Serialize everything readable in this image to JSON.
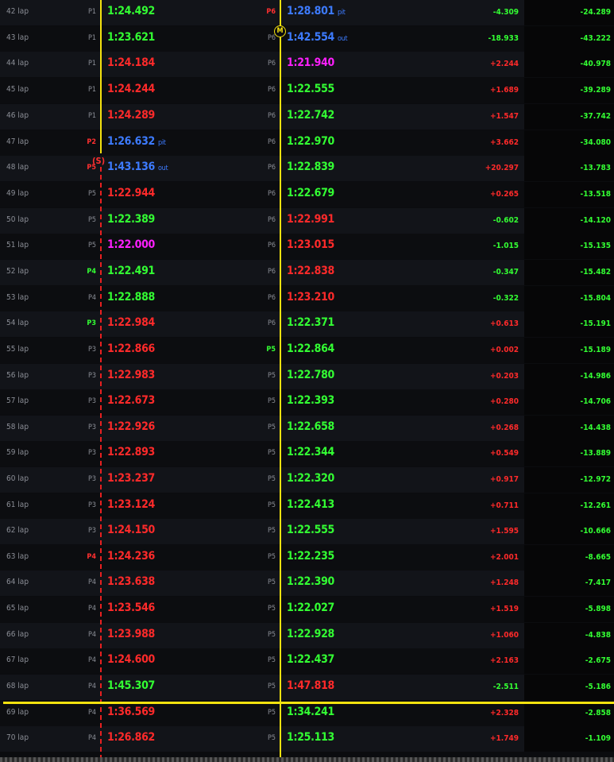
{
  "markers": {
    "driver_b_marker": "M",
    "driver_a_marker": "(S)"
  },
  "rows": [
    {
      "lap": "42 lap",
      "posA": "P1",
      "posAc": "",
      "timeA": "1:24.492",
      "colA": "green",
      "tagA": "",
      "posB": "P6",
      "posBc": "red",
      "timeB": "1:28.801",
      "colB": "blue",
      "tagB": "pit",
      "delta": "-4.309",
      "dcol": "green",
      "gap": "-24.289",
      "gcol": "green"
    },
    {
      "lap": "43 lap",
      "posA": "P1",
      "posAc": "",
      "timeA": "1:23.621",
      "colA": "green",
      "tagA": "",
      "posB": "P6",
      "posBc": "",
      "timeB": "1:42.554",
      "colB": "blue",
      "tagB": "out",
      "delta": "-18.933",
      "dcol": "green",
      "gap": "-43.222",
      "gcol": "green"
    },
    {
      "lap": "44 lap",
      "posA": "P1",
      "posAc": "",
      "timeA": "1:24.184",
      "colA": "red",
      "tagA": "",
      "posB": "P6",
      "posBc": "",
      "timeB": "1:21.940",
      "colB": "purple",
      "tagB": "",
      "delta": "+2.244",
      "dcol": "red",
      "gap": "-40.978",
      "gcol": "green"
    },
    {
      "lap": "45 lap",
      "posA": "P1",
      "posAc": "",
      "timeA": "1:24.244",
      "colA": "red",
      "tagA": "",
      "posB": "P6",
      "posBc": "",
      "timeB": "1:22.555",
      "colB": "green",
      "tagB": "",
      "delta": "+1.689",
      "dcol": "red",
      "gap": "-39.289",
      "gcol": "green"
    },
    {
      "lap": "46 lap",
      "posA": "P1",
      "posAc": "",
      "timeA": "1:24.289",
      "colA": "red",
      "tagA": "",
      "posB": "P6",
      "posBc": "",
      "timeB": "1:22.742",
      "colB": "green",
      "tagB": "",
      "delta": "+1.547",
      "dcol": "red",
      "gap": "-37.742",
      "gcol": "green"
    },
    {
      "lap": "47 lap",
      "posA": "P2",
      "posAc": "red",
      "timeA": "1:26.632",
      "colA": "blue",
      "tagA": "pit",
      "posB": "P6",
      "posBc": "",
      "timeB": "1:22.970",
      "colB": "green",
      "tagB": "",
      "delta": "+3.662",
      "dcol": "red",
      "gap": "-34.080",
      "gcol": "green"
    },
    {
      "lap": "48 lap",
      "posA": "P5",
      "posAc": "red",
      "timeA": "1:43.136",
      "colA": "blue",
      "tagA": "out",
      "posB": "P6",
      "posBc": "",
      "timeB": "1:22.839",
      "colB": "green",
      "tagB": "",
      "delta": "+20.297",
      "dcol": "red",
      "gap": "-13.783",
      "gcol": "green"
    },
    {
      "lap": "49 lap",
      "posA": "P5",
      "posAc": "",
      "timeA": "1:22.944",
      "colA": "red",
      "tagA": "",
      "posB": "P6",
      "posBc": "",
      "timeB": "1:22.679",
      "colB": "green",
      "tagB": "",
      "delta": "+0.265",
      "dcol": "red",
      "gap": "-13.518",
      "gcol": "green"
    },
    {
      "lap": "50 lap",
      "posA": "P5",
      "posAc": "",
      "timeA": "1:22.389",
      "colA": "green",
      "tagA": "",
      "posB": "P6",
      "posBc": "",
      "timeB": "1:22.991",
      "colB": "red",
      "tagB": "",
      "delta": "-0.602",
      "dcol": "green",
      "gap": "-14.120",
      "gcol": "green"
    },
    {
      "lap": "51 lap",
      "posA": "P5",
      "posAc": "",
      "timeA": "1:22.000",
      "colA": "purple",
      "tagA": "",
      "posB": "P6",
      "posBc": "",
      "timeB": "1:23.015",
      "colB": "red",
      "tagB": "",
      "delta": "-1.015",
      "dcol": "green",
      "gap": "-15.135",
      "gcol": "green"
    },
    {
      "lap": "52 lap",
      "posA": "P4",
      "posAc": "green",
      "timeA": "1:22.491",
      "colA": "green",
      "tagA": "",
      "posB": "P6",
      "posBc": "",
      "timeB": "1:22.838",
      "colB": "red",
      "tagB": "",
      "delta": "-0.347",
      "dcol": "green",
      "gap": "-15.482",
      "gcol": "green"
    },
    {
      "lap": "53 lap",
      "posA": "P4",
      "posAc": "",
      "timeA": "1:22.888",
      "colA": "green",
      "tagA": "",
      "posB": "P6",
      "posBc": "",
      "timeB": "1:23.210",
      "colB": "red",
      "tagB": "",
      "delta": "-0.322",
      "dcol": "green",
      "gap": "-15.804",
      "gcol": "green"
    },
    {
      "lap": "54 lap",
      "posA": "P3",
      "posAc": "green",
      "timeA": "1:22.984",
      "colA": "red",
      "tagA": "",
      "posB": "P6",
      "posBc": "",
      "timeB": "1:22.371",
      "colB": "green",
      "tagB": "",
      "delta": "+0.613",
      "dcol": "red",
      "gap": "-15.191",
      "gcol": "green"
    },
    {
      "lap": "55 lap",
      "posA": "P3",
      "posAc": "",
      "timeA": "1:22.866",
      "colA": "red",
      "tagA": "",
      "posB": "P5",
      "posBc": "green",
      "timeB": "1:22.864",
      "colB": "green",
      "tagB": "",
      "delta": "+0.002",
      "dcol": "red",
      "gap": "-15.189",
      "gcol": "green"
    },
    {
      "lap": "56 lap",
      "posA": "P3",
      "posAc": "",
      "timeA": "1:22.983",
      "colA": "red",
      "tagA": "",
      "posB": "P5",
      "posBc": "",
      "timeB": "1:22.780",
      "colB": "green",
      "tagB": "",
      "delta": "+0.203",
      "dcol": "red",
      "gap": "-14.986",
      "gcol": "green"
    },
    {
      "lap": "57 lap",
      "posA": "P3",
      "posAc": "",
      "timeA": "1:22.673",
      "colA": "red",
      "tagA": "",
      "posB": "P5",
      "posBc": "",
      "timeB": "1:22.393",
      "colB": "green",
      "tagB": "",
      "delta": "+0.280",
      "dcol": "red",
      "gap": "-14.706",
      "gcol": "green"
    },
    {
      "lap": "58 lap",
      "posA": "P3",
      "posAc": "",
      "timeA": "1:22.926",
      "colA": "red",
      "tagA": "",
      "posB": "P5",
      "posBc": "",
      "timeB": "1:22.658",
      "colB": "green",
      "tagB": "",
      "delta": "+0.268",
      "dcol": "red",
      "gap": "-14.438",
      "gcol": "green"
    },
    {
      "lap": "59 lap",
      "posA": "P3",
      "posAc": "",
      "timeA": "1:22.893",
      "colA": "red",
      "tagA": "",
      "posB": "P5",
      "posBc": "",
      "timeB": "1:22.344",
      "colB": "green",
      "tagB": "",
      "delta": "+0.549",
      "dcol": "red",
      "gap": "-13.889",
      "gcol": "green"
    },
    {
      "lap": "60 lap",
      "posA": "P3",
      "posAc": "",
      "timeA": "1:23.237",
      "colA": "red",
      "tagA": "",
      "posB": "P5",
      "posBc": "",
      "timeB": "1:22.320",
      "colB": "green",
      "tagB": "",
      "delta": "+0.917",
      "dcol": "red",
      "gap": "-12.972",
      "gcol": "green"
    },
    {
      "lap": "61 lap",
      "posA": "P3",
      "posAc": "",
      "timeA": "1:23.124",
      "colA": "red",
      "tagA": "",
      "posB": "P5",
      "posBc": "",
      "timeB": "1:22.413",
      "colB": "green",
      "tagB": "",
      "delta": "+0.711",
      "dcol": "red",
      "gap": "-12.261",
      "gcol": "green"
    },
    {
      "lap": "62 lap",
      "posA": "P3",
      "posAc": "",
      "timeA": "1:24.150",
      "colA": "red",
      "tagA": "",
      "posB": "P5",
      "posBc": "",
      "timeB": "1:22.555",
      "colB": "green",
      "tagB": "",
      "delta": "+1.595",
      "dcol": "red",
      "gap": "-10.666",
      "gcol": "green"
    },
    {
      "lap": "63 lap",
      "posA": "P4",
      "posAc": "red",
      "timeA": "1:24.236",
      "colA": "red",
      "tagA": "",
      "posB": "P5",
      "posBc": "",
      "timeB": "1:22.235",
      "colB": "green",
      "tagB": "",
      "delta": "+2.001",
      "dcol": "red",
      "gap": "-8.665",
      "gcol": "green"
    },
    {
      "lap": "64 lap",
      "posA": "P4",
      "posAc": "",
      "timeA": "1:23.638",
      "colA": "red",
      "tagA": "",
      "posB": "P5",
      "posBc": "",
      "timeB": "1:22.390",
      "colB": "green",
      "tagB": "",
      "delta": "+1.248",
      "dcol": "red",
      "gap": "-7.417",
      "gcol": "green"
    },
    {
      "lap": "65 lap",
      "posA": "P4",
      "posAc": "",
      "timeA": "1:23.546",
      "colA": "red",
      "tagA": "",
      "posB": "P5",
      "posBc": "",
      "timeB": "1:22.027",
      "colB": "green",
      "tagB": "",
      "delta": "+1.519",
      "dcol": "red",
      "gap": "-5.898",
      "gcol": "green"
    },
    {
      "lap": "66 lap",
      "posA": "P4",
      "posAc": "",
      "timeA": "1:23.988",
      "colA": "red",
      "tagA": "",
      "posB": "P5",
      "posBc": "",
      "timeB": "1:22.928",
      "colB": "green",
      "tagB": "",
      "delta": "+1.060",
      "dcol": "red",
      "gap": "-4.838",
      "gcol": "green"
    },
    {
      "lap": "67 lap",
      "posA": "P4",
      "posAc": "",
      "timeA": "1:24.600",
      "colA": "red",
      "tagA": "",
      "posB": "P5",
      "posBc": "",
      "timeB": "1:22.437",
      "colB": "green",
      "tagB": "",
      "delta": "+2.163",
      "dcol": "red",
      "gap": "-2.675",
      "gcol": "green"
    },
    {
      "lap": "68 lap",
      "posA": "P4",
      "posAc": "",
      "timeA": "1:45.307",
      "colA": "green",
      "tagA": "",
      "posB": "P5",
      "posBc": "",
      "timeB": "1:47.818",
      "colB": "red",
      "tagB": "",
      "delta": "-2.511",
      "dcol": "green",
      "gap": "-5.186",
      "gcol": "green"
    },
    {
      "lap": "69 lap",
      "posA": "P4",
      "posAc": "",
      "timeA": "1:36.569",
      "colA": "red",
      "tagA": "",
      "posB": "P5",
      "posBc": "",
      "timeB": "1:34.241",
      "colB": "green",
      "tagB": "",
      "delta": "+2.328",
      "dcol": "red",
      "gap": "-2.858",
      "gcol": "green"
    },
    {
      "lap": "70 lap",
      "posA": "P4",
      "posAc": "",
      "timeA": "1:26.862",
      "colA": "red",
      "tagA": "",
      "posB": "P5",
      "posBc": "",
      "timeB": "1:25.113",
      "colB": "green",
      "tagB": "",
      "delta": "+1.749",
      "dcol": "red",
      "gap": "-1.109",
      "gcol": "green"
    }
  ]
}
